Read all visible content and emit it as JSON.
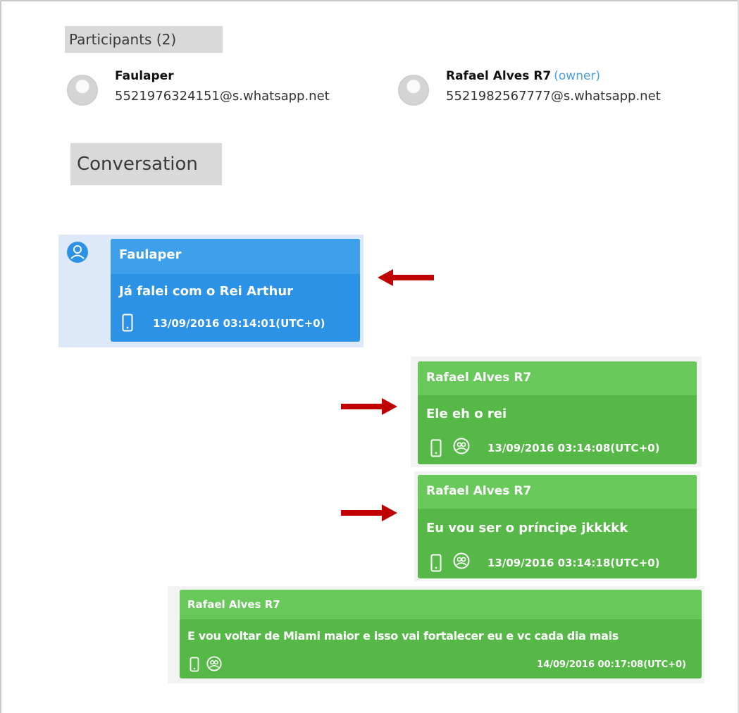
{
  "participants_title": "Participants (2)",
  "participants": [
    {
      "name": "Faulaper",
      "jid": "5521976324151@s.whatsapp.net",
      "owner_tag": ""
    },
    {
      "name": "Rafael Alves R7",
      "jid": "5521982567777@s.whatsapp.net",
      "owner_tag": "(owner)"
    }
  ],
  "conversation_title": "Conversation",
  "messages": [
    {
      "sender": "Faulaper",
      "text": "Já falei com o Rei Arthur",
      "timestamp": "13/09/2016 03:14:01(UTC+0)",
      "direction": "incoming",
      "color": "#2b92e6"
    },
    {
      "sender": "Rafael Alves R7",
      "text": "Ele eh o rei",
      "timestamp": "13/09/2016 03:14:08(UTC+0)",
      "direction": "outgoing",
      "color": "#56b947"
    },
    {
      "sender": "Rafael Alves R7",
      "text": "Eu vou ser o príncipe jkkkkk",
      "timestamp": "13/09/2016 03:14:18(UTC+0)",
      "direction": "outgoing",
      "color": "#56b947"
    },
    {
      "sender": "Rafael Alves R7",
      "text": "E vou voltar de Miami maior e isso vai fortalecer eu e vc cada dia mais",
      "timestamp": "14/09/2016 00:17:08(UTC+0)",
      "direction": "outgoing",
      "color": "#56b947"
    }
  ],
  "arrow_color": "#c00000"
}
